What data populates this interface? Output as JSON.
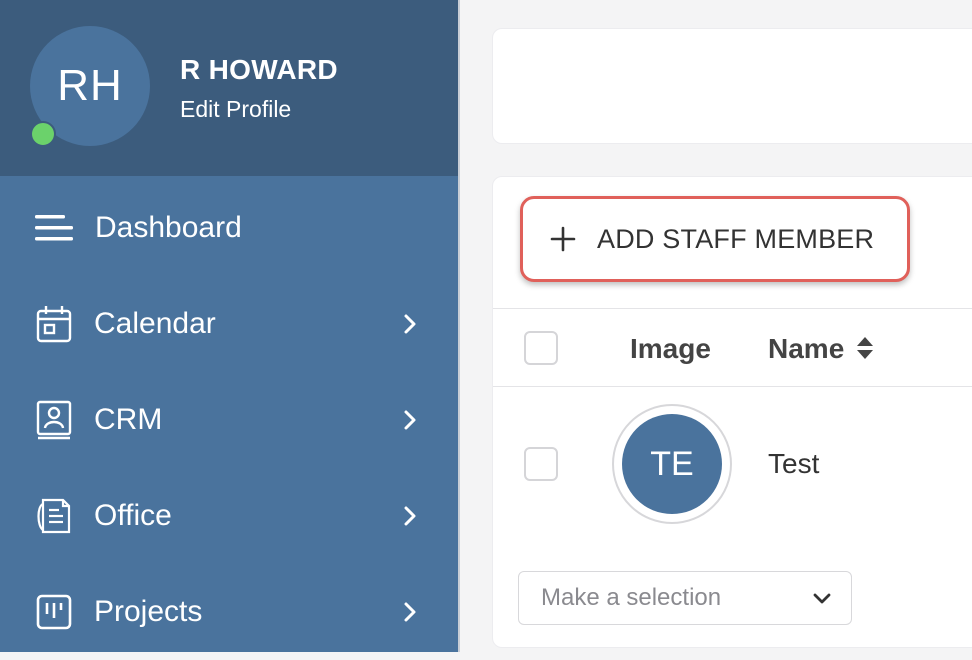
{
  "profile": {
    "initials": "RH",
    "name": "R HOWARD",
    "edit_label": "Edit Profile",
    "status_color": "#6bd26b"
  },
  "nav": {
    "items": [
      {
        "label": "Dashboard",
        "icon": "menu-icon",
        "has_chevron": false
      },
      {
        "label": "Calendar",
        "icon": "calendar-icon",
        "has_chevron": true
      },
      {
        "label": "CRM",
        "icon": "contact-book-icon",
        "has_chevron": true
      },
      {
        "label": "Office",
        "icon": "documents-icon",
        "has_chevron": true
      },
      {
        "label": "Projects",
        "icon": "kanban-board-icon",
        "has_chevron": true
      }
    ]
  },
  "toolbar": {
    "add_staff_label": "ADD STAFF MEMBER",
    "highlight_color": "#e0605a"
  },
  "table": {
    "columns": [
      "Image",
      "Name"
    ],
    "rows": [
      {
        "initials": "TE",
        "name": "Test",
        "checked": false
      }
    ]
  },
  "bulk_action": {
    "placeholder": "Make a selection"
  },
  "colors": {
    "sidebar": "#4a739d",
    "profile_header": "#3c5c7d",
    "accent": "#4a739d"
  }
}
